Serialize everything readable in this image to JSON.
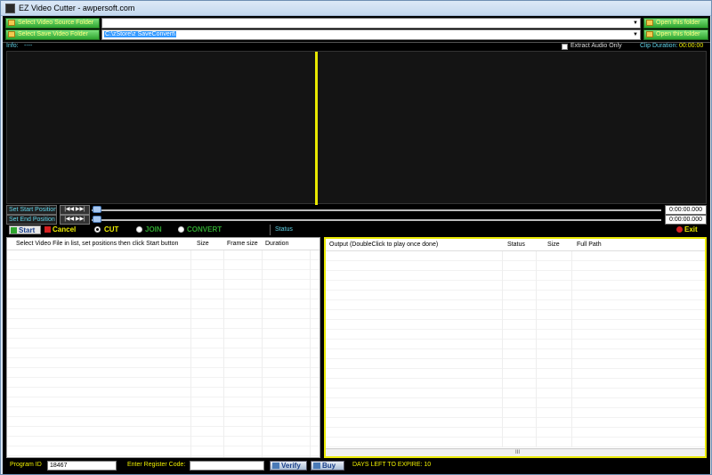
{
  "window": {
    "title": "EZ Video Cutter - awpersoft.com"
  },
  "source": {
    "select_source_label": "Select Video Source Folder",
    "source_path": "",
    "open_source_label": "Open this folder",
    "select_save_label": "Select Save Video Folder",
    "save_path": "C:\\zStore\\z SaveConvert\\",
    "open_save_label": "Open this folder"
  },
  "info": {
    "label": "Info:",
    "value": "----",
    "extract_audio_label": "Extract Audio Only",
    "clip_duration_label": "Clip Duration:",
    "clip_duration_value": "00:00:00"
  },
  "positions": {
    "start_label": "Set Start Position",
    "end_label": "Set End Position",
    "nav_glyph": "|◀◀ ▶▶|",
    "start_time": "0:00:00.000",
    "end_time": "0:00:00.000"
  },
  "toolbar": {
    "start_label": "Start",
    "cancel_label": "Cancel",
    "modes": [
      {
        "label": "CUT",
        "selected": true
      },
      {
        "label": "JOIN",
        "selected": false
      },
      {
        "label": "CONVERT",
        "selected": false
      }
    ],
    "status_label": "Status",
    "exit_label": "Exit"
  },
  "input_list": {
    "columns": [
      "Select Video File in list, set positions then click Start button",
      "Size",
      "Frame size",
      "Duration"
    ]
  },
  "output_list": {
    "columns": [
      "Output (DoubleClick to play once done)",
      "Status",
      "Size",
      "Full Path"
    ],
    "scroll_grip": "III"
  },
  "status_bar": {
    "program_id_label": "Program ID",
    "program_id_value": "18467",
    "register_label": "Enter Register Code:",
    "register_value": "",
    "verify_label": "Verify",
    "buy_label": "Buy",
    "expire_text": "DAYS LEFT TO EXPIRE: 10"
  },
  "colors": {
    "accent_yellow": "#f0f000",
    "accent_cyan": "#5fd3e8",
    "button_green": "#2fa52f"
  }
}
